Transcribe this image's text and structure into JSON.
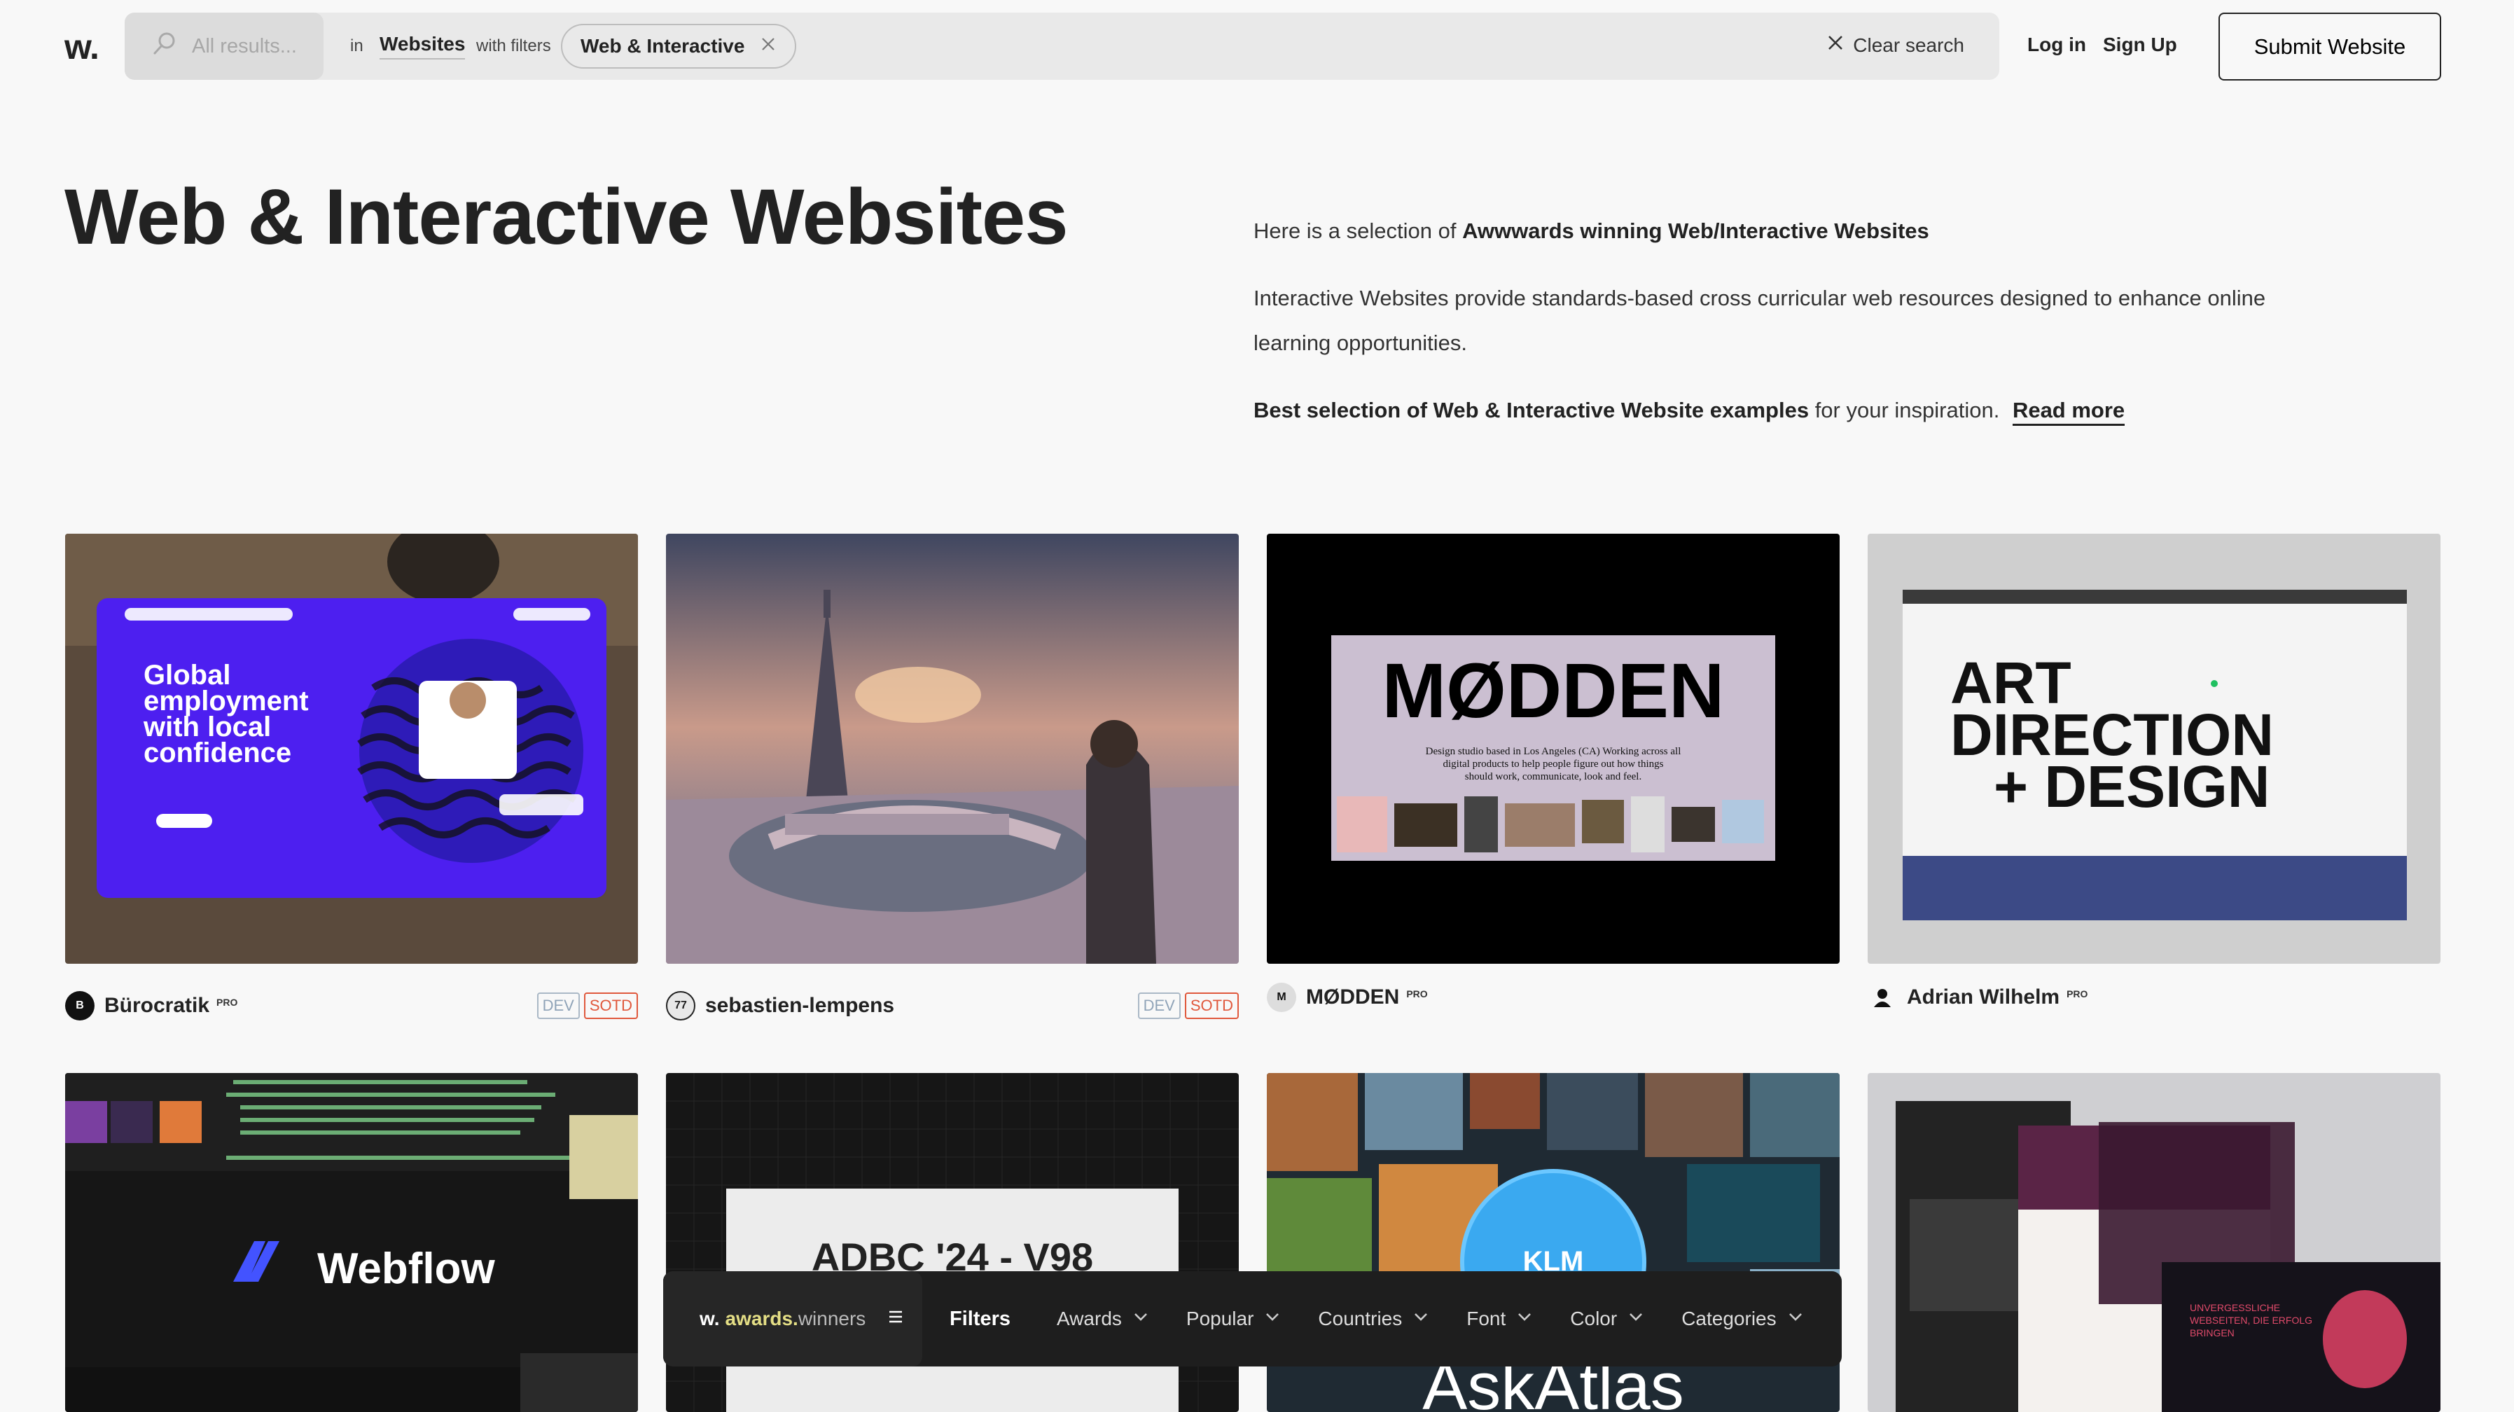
{
  "header": {
    "logo": "w.",
    "search_placeholder": "All results...",
    "in_label": "in",
    "scope": "Websites",
    "with_filters_label": "with filters",
    "active_filter": "Web & Interactive",
    "clear_search": "Clear search",
    "login": "Log in",
    "signup": "Sign Up",
    "submit": "Submit Website"
  },
  "hero": {
    "title": "Web & Interactive Websites",
    "line1_prefix": "Here is a selection of ",
    "line1_bold": "Awwwards winning Web/Interactive Websites",
    "line2": "Interactive Websites provide standards-based cross curricular web resources designed to enhance online learning opportunities.",
    "line3_bold": "Best selection of Web & Interactive Website examples",
    "line3_rest": " for your inspiration.",
    "read_more": "Read more"
  },
  "cards": [
    {
      "name": "Bürocratik",
      "pro": "PRO",
      "badges": [
        "DEV",
        "SOTD"
      ],
      "thumb_text": [
        "Global",
        "employment",
        "with local",
        "confidence"
      ]
    },
    {
      "name": "sebastien-lempens",
      "pro": "",
      "badges": [
        "DEV",
        "SOTD"
      ],
      "thumb_text": []
    },
    {
      "name": "MØDDEN",
      "pro": "PRO",
      "badges": [],
      "thumb_text": [
        "MØDDEN",
        "Design studio based in Los Angeles (CA) Working across all",
        "digital products to help people figure out how things",
        "should work, communicate, look and feel."
      ]
    },
    {
      "name": "Adrian Wilhelm",
      "pro": "PRO",
      "badges": [],
      "thumb_text": [
        "ART",
        "DIRECTION",
        "+ DESIGN"
      ]
    },
    {
      "thumb_text": [
        "Webflow"
      ]
    },
    {
      "thumb_text": [
        "ADBC '24 - V98"
      ]
    },
    {
      "thumb_text": [
        "KLM",
        "AskAtlas"
      ]
    },
    {
      "thumb_text": [
        "UNVERGESSLICHE",
        "WEBSEITEN, DIE ERFOLG",
        "BRINGEN"
      ]
    }
  ],
  "filterbar": {
    "logo_w": "w.",
    "logo_awards": "awards.",
    "logo_winners": "winners",
    "title": "Filters",
    "items": [
      "Awards",
      "Popular",
      "Countries",
      "Font",
      "Color",
      "Categories"
    ]
  }
}
